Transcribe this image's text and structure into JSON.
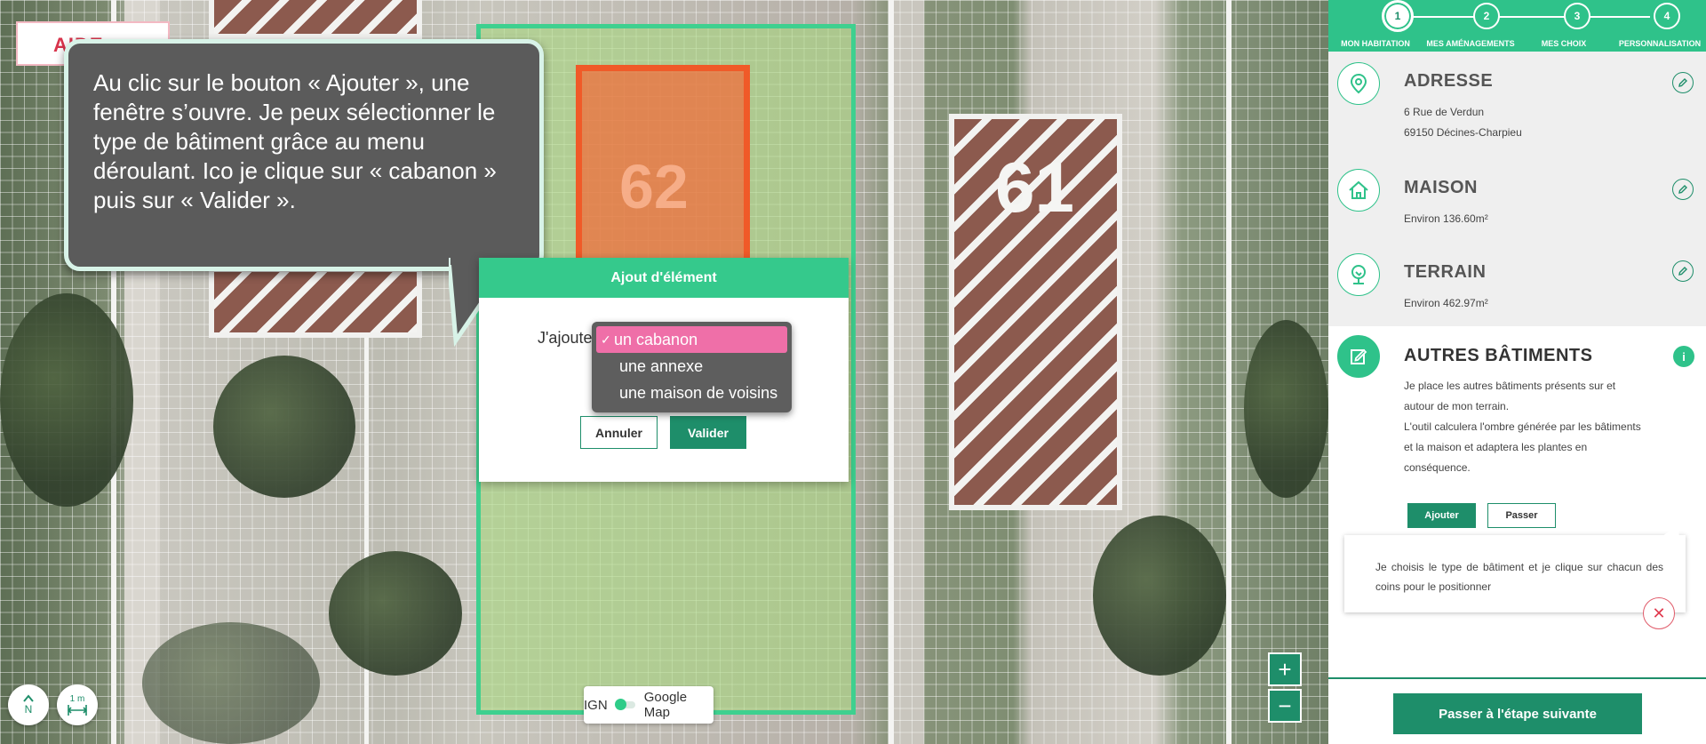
{
  "map": {
    "badge_text": "AIDE",
    "parcel_number_left": "62",
    "parcel_number_right": "61",
    "compass_label": "N",
    "scale_label": "1 m",
    "zoom_in": "+",
    "zoom_out": "−",
    "layer_toggle": {
      "left_label": "IGN",
      "right_label": "Google Map"
    }
  },
  "tooltip": {
    "text": "Au clic sur le bouton « Ajouter », une fenêtre s’ouvre. Je peux sélectionner le type de bâtiment grâce au menu déroulant. Ico je clique sur « cabanon » puis sur « Valider »."
  },
  "modal": {
    "title": "Ajout d'élément",
    "label": "J'ajoute",
    "cancel_label": "Annuler",
    "validate_label": "Valider",
    "dropdown": {
      "check": "✓",
      "options": [
        "un cabanon",
        "une annexe",
        "une maison de voisins"
      ],
      "selected": "un cabanon"
    }
  },
  "stepper": {
    "steps": [
      {
        "number": "1",
        "label": "MON HABITATION"
      },
      {
        "number": "2",
        "label": "MES AMÉNAGEMENTS"
      },
      {
        "number": "3",
        "label": "MES CHOIX"
      },
      {
        "number": "4",
        "label": "PERSONNALISATION"
      }
    ],
    "active": "1"
  },
  "sidebar": {
    "address": {
      "title": "ADRESSE",
      "line1": "6 Rue de Verdun",
      "line2": "69150 Décines-Charpieu"
    },
    "house": {
      "title": "MAISON",
      "text": "Environ 136.60m²"
    },
    "land": {
      "title": "TERRAIN",
      "text": "Environ 462.97m²"
    },
    "other": {
      "title": "AUTRES BÂTIMENTS",
      "info": "i",
      "line1": "Je place les autres bâtiments présents sur et",
      "line2": "autour de mon terrain.",
      "line3": "L'outil calculera l'ombre générée par les bâtiments",
      "line4": "et la maison et adaptera les plantes en",
      "line5": "conséquence.",
      "add_label": "Ajouter",
      "skip_label": "Passer"
    },
    "hint": "Je choisis le type de bâtiment et je clique sur chacun des coins pour le positionner",
    "close": "✕",
    "next_label": "Passer à l'étape suivante"
  },
  "colors": {
    "accent": "#2fc28a",
    "dark_accent": "#1e8e6a",
    "parcel_border": "#3ed08f",
    "building": "#f05a28",
    "selected_option": "#ef6fa8"
  }
}
